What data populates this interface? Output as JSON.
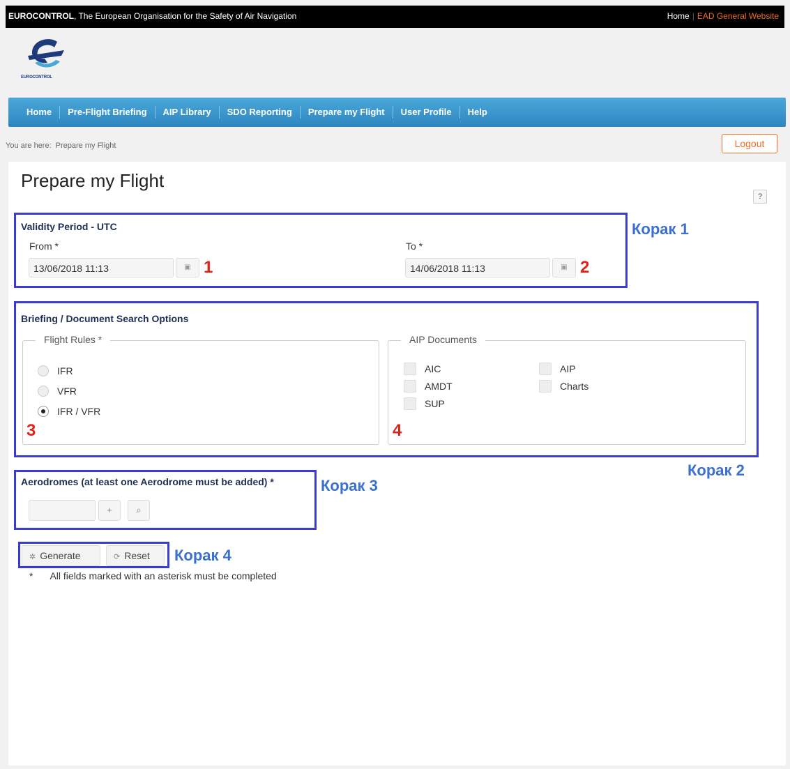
{
  "topbar": {
    "brand": "EUROCONTROL",
    "tagline": ", The European Organisation for the Safety of Air Navigation",
    "home_link": "Home",
    "separator": "|",
    "ead_link": "EAD General Website"
  },
  "logo": {
    "text": "EUROCONTROL"
  },
  "nav": {
    "items": [
      {
        "label": "Home"
      },
      {
        "label": "Pre-Flight Briefing"
      },
      {
        "label": "AIP Library"
      },
      {
        "label": "SDO Reporting"
      },
      {
        "label": "Prepare my Flight"
      },
      {
        "label": "User Profile"
      },
      {
        "label": "Help"
      }
    ]
  },
  "breadcrumb": {
    "prefix": "You are here:",
    "current": "Prepare my Flight"
  },
  "logout_label": "Logout",
  "page_title": "Prepare my Flight",
  "help_label": "?",
  "validity": {
    "title": "Validity Period - UTC",
    "from_label": "From *",
    "from_value": "13/06/2018 11:13",
    "to_label": "To *",
    "to_value": "14/06/2018 11:13"
  },
  "search_options": {
    "title": "Briefing / Document Search Options",
    "flight_rules": {
      "legend": "Flight Rules *",
      "options": [
        {
          "label": "IFR",
          "checked": false
        },
        {
          "label": "VFR",
          "checked": false
        },
        {
          "label": "IFR / VFR",
          "checked": true
        }
      ]
    },
    "aip_documents": {
      "legend": "AIP Documents",
      "items": [
        {
          "label": "AIC"
        },
        {
          "label": "AMDT"
        },
        {
          "label": "SUP"
        },
        {
          "label": "AIP"
        },
        {
          "label": "Charts"
        }
      ]
    }
  },
  "aerodromes": {
    "title": "Aerodromes (at least one Aerodrome must be added) *",
    "add": "+",
    "search": "⌕"
  },
  "actions": {
    "generate_label": "Generate",
    "reset_label": "Reset",
    "generate_icon": "✲",
    "reset_icon": "⟳"
  },
  "note": {
    "star": "*",
    "text": "All fields marked with an asterisk must be completed"
  },
  "annotations": {
    "steps": [
      "Корак 1",
      "Корак 2",
      "Корак 3",
      "Корак 4"
    ],
    "numbers": [
      "1",
      "2",
      "3",
      "4"
    ],
    "box_color": "#3b3bd1",
    "step_color": "#3b6fd1",
    "number_color": "#e2231a"
  }
}
